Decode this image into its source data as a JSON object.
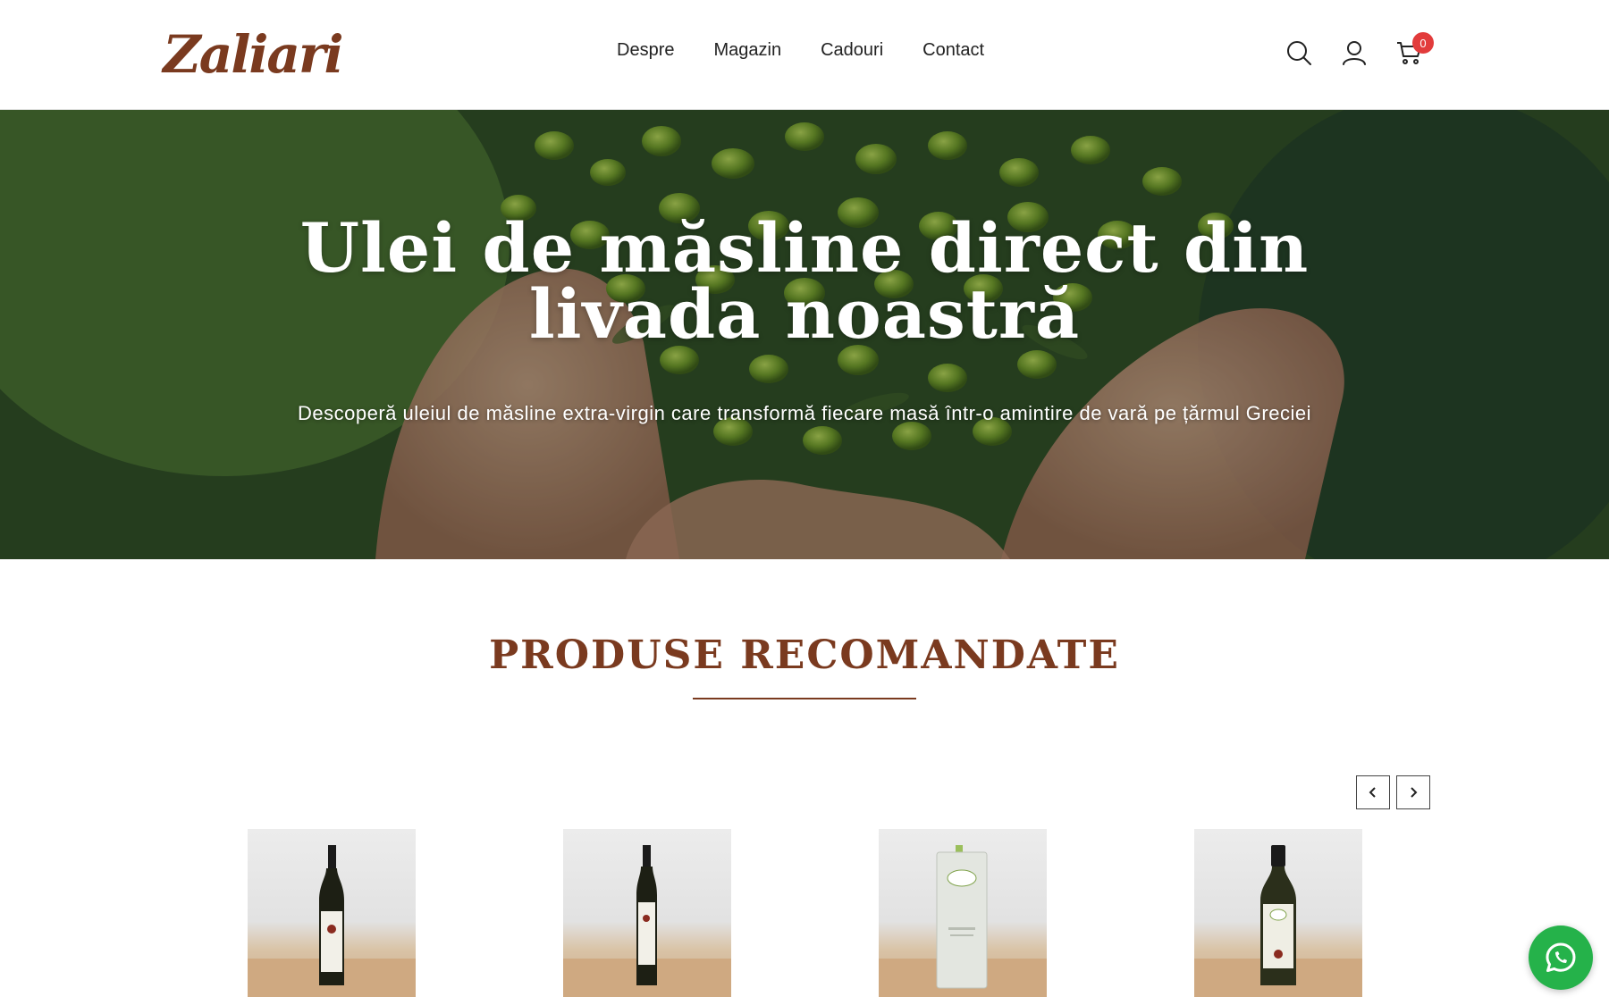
{
  "brand": {
    "logo_text": "Zaliari",
    "color": "#7a3a1f"
  },
  "nav": {
    "items": [
      {
        "label": "Despre"
      },
      {
        "label": "Magazin"
      },
      {
        "label": "Cadouri"
      },
      {
        "label": "Contact"
      }
    ]
  },
  "header_icons": {
    "search": "search-icon",
    "account": "user-icon",
    "cart": "cart-icon",
    "cart_count": "0",
    "badge_color": "#e23b3b"
  },
  "hero": {
    "title_line1": "Ulei de măsline direct din",
    "title_line2": "livada noastră",
    "subtitle": "Descoperă uleiul de măsline extra-virgin care transformă fiecare masă într-o amintire de vară pe țărmul Greciei"
  },
  "featured": {
    "title": "PRODUSE RECOMANDATE",
    "prev_icon": "chevron-left-icon",
    "next_icon": "chevron-right-icon",
    "products": [
      {
        "name": "olive-oil-bottle-tall"
      },
      {
        "name": "olive-oil-bottle-slim"
      },
      {
        "name": "olive-oil-tin"
      },
      {
        "name": "olive-oil-bottle-small"
      }
    ]
  },
  "whatsapp": {
    "icon": "whatsapp-icon",
    "color": "#25b24a"
  }
}
